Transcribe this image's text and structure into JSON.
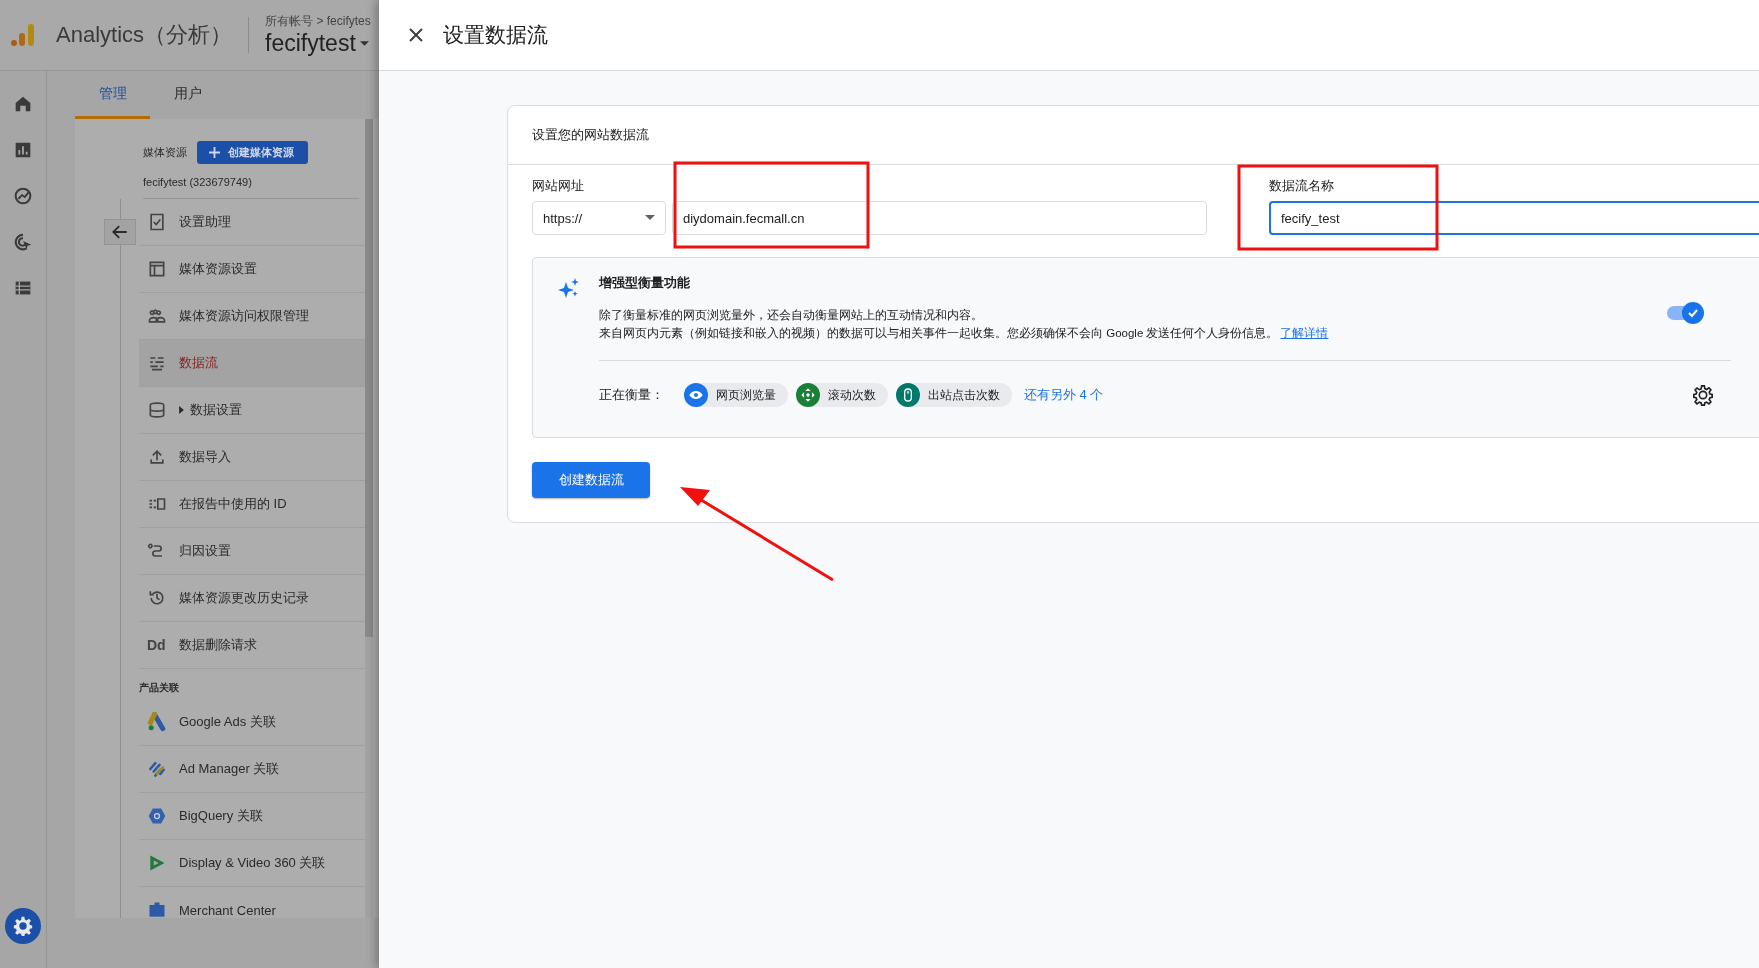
{
  "app": {
    "name": "Analytics（分析）",
    "breadcrumb": "所有帐号 > fecifytes",
    "property": "fecifytest"
  },
  "tabs": [
    {
      "label": "管理",
      "selected": true
    },
    {
      "label": "用户",
      "selected": false
    }
  ],
  "property_header": {
    "label": "媒体资源",
    "create_button": "创建媒体资源",
    "property_id": "fecifytest (323679749)"
  },
  "menu": [
    {
      "label": "设置助理",
      "selected": false,
      "has_children": false
    },
    {
      "label": "媒体资源设置",
      "selected": false,
      "has_children": false
    },
    {
      "label": "媒体资源访问权限管理",
      "selected": false,
      "has_children": false
    },
    {
      "label": "数据流",
      "selected": true,
      "has_children": false
    },
    {
      "label": "数据设置",
      "selected": false,
      "has_children": true
    },
    {
      "label": "数据导入",
      "selected": false,
      "has_children": false
    },
    {
      "label": "在报告中使用的 ID",
      "selected": false,
      "has_children": false
    },
    {
      "label": "归因设置",
      "selected": false,
      "has_children": false
    },
    {
      "label": "媒体资源更改历史记录",
      "selected": false,
      "has_children": false
    },
    {
      "label": "数据删除请求",
      "selected": false,
      "has_children": false,
      "icon_text": "Dd"
    }
  ],
  "links_section": {
    "title": "产品关联",
    "items": [
      "Google Ads 关联",
      "Ad Manager 关联",
      "BigQuery 关联",
      "Display & Video 360 关联",
      "Merchant Center"
    ]
  },
  "panel": {
    "title": "设置数据流",
    "card_title": "设置您的网站数据流",
    "url_label": "网站网址",
    "protocol": "https://",
    "url_value": "diydomain.fecmall.cn",
    "name_label": "数据流名称",
    "name_value": "fecify_test",
    "name_focused": true
  },
  "enhanced": {
    "title": "增强型衡量功能",
    "lines": [
      "除了衡量标准的网页浏览量外，还会自动衡量网站上的互动情况和内容。",
      "来自网页内元素（例如链接和嵌入的视频）的数据可以与相关事件一起收集。您必须确保不会向 Google 发送任何个人身份信息。"
    ],
    "link": "了解详情",
    "on": true,
    "measuring_label": "正在衡量：",
    "chips": [
      {
        "label": "网页浏览量",
        "color": "#1a73e8"
      },
      {
        "label": "滚动次数",
        "color": "#188038"
      },
      {
        "label": "出站点击次数",
        "color": "#00796b"
      }
    ],
    "more": "还有另外 4 个"
  },
  "create_button": "创建数据流"
}
